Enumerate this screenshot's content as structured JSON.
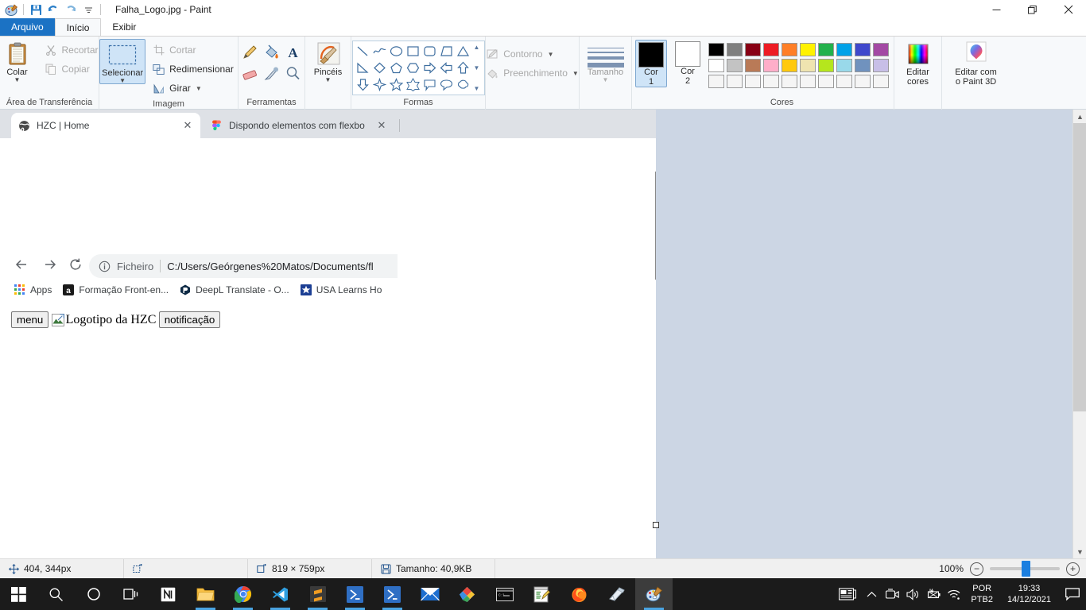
{
  "window": {
    "title": "Falha_Logo.jpg - Paint",
    "quick_access": [
      "paint-icon",
      "save-icon",
      "undo-icon",
      "redo-icon",
      "customize-icon"
    ],
    "controls": {
      "minimize": "minimize-icon",
      "maximize": "maximize-icon",
      "close": "close-icon"
    },
    "help_label": "?"
  },
  "ribbon": {
    "tabs": [
      {
        "label": "Arquivo",
        "kind": "file"
      },
      {
        "label": "Início",
        "kind": "active"
      },
      {
        "label": "Exibir",
        "kind": "normal"
      }
    ],
    "groups": [
      {
        "label": "Área de Transferência",
        "paste": "Colar",
        "cut": "Recortar",
        "copy": "Copiar"
      },
      {
        "label": "Imagem",
        "select": "Selecionar",
        "crop": "Cortar",
        "resize": "Redimensionar",
        "rotate": "Girar"
      },
      {
        "label": "Ferramentas"
      },
      {
        "label": "",
        "brushes": "Pincéis"
      },
      {
        "label": "Formas"
      },
      {
        "label": "",
        "outline": "Contorno",
        "fill": "Preenchimento"
      },
      {
        "label": "",
        "size": "Tamanho"
      },
      {
        "label": "Cores",
        "color1_l1": "Cor",
        "color1_l2": "1",
        "color2_l1": "Cor",
        "color2_l2": "2"
      },
      {
        "label": "",
        "edit_colors_l1": "Editar",
        "edit_colors_l2": "cores",
        "paint3d_l1": "Editar com",
        "paint3d_l2": "o Paint 3D"
      }
    ],
    "colors": {
      "color1": "#000000",
      "color2": "#ffffff",
      "row1": [
        "#000000",
        "#7f7f7f",
        "#880015",
        "#ed1c24",
        "#ff7f27",
        "#fff200",
        "#22b14c",
        "#00a2e8",
        "#3f48cc",
        "#a349a4"
      ],
      "row2": [
        "#ffffff",
        "#c3c3c3",
        "#b97a57",
        "#ffaec9",
        "#ffc90e",
        "#efe4b0",
        "#b5e61d",
        "#99d9ea",
        "#7092be",
        "#c8bfe7"
      ],
      "row3": [
        "#f5f5f5",
        "#f5f5f5",
        "#f5f5f5",
        "#f5f5f5",
        "#f5f5f5",
        "#f5f5f5",
        "#f5f5f5",
        "#f5f5f5",
        "#f5f5f5",
        "#f5f5f5"
      ]
    }
  },
  "canvas_image": {
    "browser": {
      "tabs": [
        {
          "title": "HZC | Home",
          "favicon": "globe-icon",
          "active": true
        },
        {
          "title": "Dispondo elementos com flexbo",
          "favicon": "figma-icon",
          "active": false
        }
      ],
      "nav": {
        "back": "back-icon",
        "forward": "forward-icon",
        "reload": "reload-icon"
      },
      "omnibox": {
        "scheme_label": "Ficheiro",
        "url": "C:/Users/Geórgenes%20Matos/Documents/fl"
      },
      "bookmarks": [
        {
          "label": "Apps",
          "icon": "apps-grid-icon"
        },
        {
          "label": "Formação Front-en...",
          "icon": "alura-icon"
        },
        {
          "label": "DeepL Translate - O...",
          "icon": "deepl-icon"
        },
        {
          "label": "USA Learns Ho",
          "icon": "usalearns-icon"
        }
      ],
      "page": {
        "menu_button": "menu",
        "image_alt": "Logotipo da HZC",
        "notification_button": "notificação"
      }
    }
  },
  "statusbar": {
    "cursor_pos": "404, 344px",
    "selection_icon": "selection-size-icon",
    "image_size": "819 × 759px",
    "file_size": "Tamanho: 40,9KB",
    "zoom_level": "100%",
    "zoom_out": "−",
    "zoom_in": "+"
  },
  "taskbar": {
    "items": [
      {
        "name": "start-button",
        "icon": "windows-logo-icon"
      },
      {
        "name": "search-button",
        "icon": "search-icon"
      },
      {
        "name": "cortana-button",
        "icon": "cortana-circle-icon"
      },
      {
        "name": "task-view-button",
        "icon": "task-view-icon"
      },
      {
        "name": "notion-app",
        "icon": "notion-icon"
      },
      {
        "name": "file-explorer-app",
        "icon": "folder-icon"
      },
      {
        "name": "chrome-app",
        "icon": "chrome-icon"
      },
      {
        "name": "vscode-app",
        "icon": "vscode-icon"
      },
      {
        "name": "sublime-text-app",
        "icon": "sublime-icon"
      },
      {
        "name": "powershell-app",
        "icon": "powershell-icon"
      },
      {
        "name": "powershell-2-app",
        "icon": "powershell-icon"
      },
      {
        "name": "mail-app",
        "icon": "mail-icon"
      },
      {
        "name": "office-app",
        "icon": "office-icon"
      },
      {
        "name": "terminal-app",
        "icon": "terminal-icon"
      },
      {
        "name": "notepadpp-app",
        "icon": "notepadpp-icon"
      },
      {
        "name": "firefox-app",
        "icon": "firefox-icon"
      },
      {
        "name": "sticky-notes-app",
        "icon": "sticky-notes-icon"
      },
      {
        "name": "paint-app",
        "icon": "paint-icon"
      }
    ],
    "tray": {
      "news_icon": "news-weather-icon",
      "overflow_icon": "chevron-up-icon",
      "camera_icon": "camera-icon",
      "volume_icon": "volume-icon",
      "battery_icon": "battery-icon",
      "wifi_icon": "wifi-icon",
      "lang_line1": "POR",
      "lang_line2": "PTB2",
      "time": "19:33",
      "date": "14/12/2021",
      "action_center_icon": "action-center-icon"
    }
  }
}
